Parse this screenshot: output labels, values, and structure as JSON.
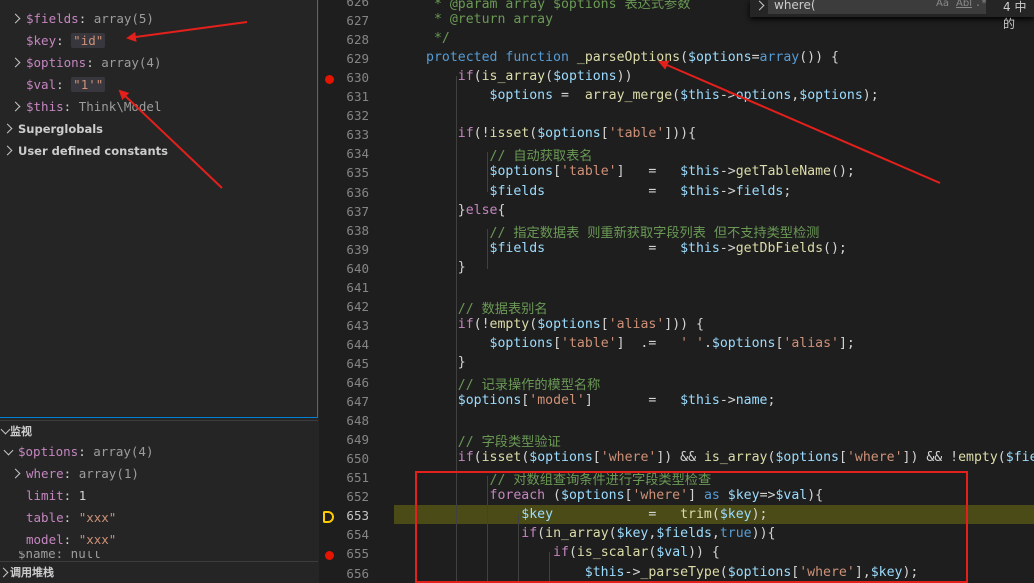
{
  "variables": [
    {
      "name": "$fields",
      "type": "array(5)",
      "expandable": true
    },
    {
      "name": "$key",
      "value": "\"id\"",
      "expandable": false
    },
    {
      "name": "$options",
      "type": "array(4)",
      "expandable": true
    },
    {
      "name": "$val",
      "value": "\"1'\"",
      "expandable": false
    },
    {
      "name": "$this",
      "type": "Think\\Model",
      "expandable": true
    }
  ],
  "sections": [
    "Superglobals",
    "User defined constants"
  ],
  "watch": {
    "title": "监视",
    "root": {
      "name": "$options",
      "type": "array(4)"
    },
    "children": [
      {
        "name": "where",
        "value": "array(1)",
        "kind": "type",
        "expandable": true
      },
      {
        "name": "limit",
        "value": "1",
        "kind": "num"
      },
      {
        "name": "table",
        "value": "\"xxx\"",
        "kind": "str"
      },
      {
        "name": "model",
        "value": "\"xxx\"",
        "kind": "str"
      }
    ],
    "partial": "$name: null"
  },
  "callstack": {
    "title": "调用堆栈"
  },
  "find": {
    "query": "where(",
    "aa": "Aa",
    "ab": "Abl",
    "regex": ".*",
    "result": "4 中的"
  },
  "editor": {
    "current_line": 653,
    "breakpoints": [
      630,
      655
    ],
    "lines": [
      {
        "n": 626,
        "html": "<span class=\"cm\"> * @param array $options 表达式参数</span>"
      },
      {
        "n": 627,
        "html": "<span class=\"cm\"> * @return array</span>"
      },
      {
        "n": 628,
        "html": "<span class=\"cm\"> */</span>"
      },
      {
        "n": 629,
        "html": "<span class=\"kw\">protected function</span> <span class=\"fn\">_parseOptions</span>(<span class=\"var\">$options</span>=<span class=\"kw\">array</span>()) {"
      },
      {
        "n": 630,
        "html": "    <span class=\"kw2\">if</span>(<span class=\"fn\">is_array</span>(<span class=\"var\">$options</span>))"
      },
      {
        "n": 631,
        "html": "        <span class=\"var\">$options</span> =  <span class=\"fn\">array_merge</span>(<span class=\"var\">$this</span>-><span class=\"var\">options</span>,<span class=\"var\">$options</span>);"
      },
      {
        "n": 632,
        "html": ""
      },
      {
        "n": 633,
        "html": "    <span class=\"kw2\">if</span>(!<span class=\"fn\">isset</span>(<span class=\"var\">$options</span>[<span class=\"str\">'table'</span>])){"
      },
      {
        "n": 634,
        "html": "        <span class=\"cm\">// 自动获取表名</span>"
      },
      {
        "n": 635,
        "html": "        <span class=\"var\">$options</span>[<span class=\"str\">'table'</span>]   =   <span class=\"var\">$this</span>-><span class=\"fn\">getTableName</span>();"
      },
      {
        "n": 636,
        "html": "        <span class=\"var\">$fields</span>             =   <span class=\"var\">$this</span>-><span class=\"var\">fields</span>;"
      },
      {
        "n": 637,
        "html": "    }<span class=\"kw2\">else</span>{"
      },
      {
        "n": 638,
        "html": "        <span class=\"cm\">// 指定数据表 则重新获取字段列表 但不支持类型检测</span>"
      },
      {
        "n": 639,
        "html": "        <span class=\"var\">$fields</span>             =   <span class=\"var\">$this</span>-><span class=\"fn\">getDbFields</span>();"
      },
      {
        "n": 640,
        "html": "    }"
      },
      {
        "n": 641,
        "html": ""
      },
      {
        "n": 642,
        "html": "    <span class=\"cm\">// 数据表别名</span>"
      },
      {
        "n": 643,
        "html": "    <span class=\"kw2\">if</span>(!<span class=\"fn\">empty</span>(<span class=\"var\">$options</span>[<span class=\"str\">'alias'</span>])) {"
      },
      {
        "n": 644,
        "html": "        <span class=\"var\">$options</span>[<span class=\"str\">'table'</span>]  .=   <span class=\"str\">' '</span>.<span class=\"var\">$options</span>[<span class=\"str\">'alias'</span>];"
      },
      {
        "n": 645,
        "html": "    }"
      },
      {
        "n": 646,
        "html": "    <span class=\"cm\">// 记录操作的模型名称</span>"
      },
      {
        "n": 647,
        "html": "    <span class=\"var\">$options</span>[<span class=\"str\">'model'</span>]       =   <span class=\"var\">$this</span>-><span class=\"var\">name</span>;"
      },
      {
        "n": 648,
        "html": ""
      },
      {
        "n": 649,
        "html": "    <span class=\"cm\">// 字段类型验证</span>"
      },
      {
        "n": 650,
        "html": "    <span class=\"kw2\">if</span>(<span class=\"fn\">isset</span>(<span class=\"var\">$options</span>[<span class=\"str\">'where'</span>]) &amp;&amp; <span class=\"fn\">is_array</span>(<span class=\"var\">$options</span>[<span class=\"str\">'where'</span>]) &amp;&amp; !<span class=\"fn\">empty</span>(<span class=\"var\">$fields</span>"
      },
      {
        "n": 651,
        "html": "        <span class=\"cm\">// 对数组查询条件进行字段类型检查</span>"
      },
      {
        "n": 652,
        "html": "        <span class=\"kw2\">foreach</span> (<span class=\"var\">$options</span>[<span class=\"str\">'where'</span>] <span class=\"kw\">as</span> <span class=\"var\">$key</span>=><span class=\"var\">$val</span>){"
      },
      {
        "n": 653,
        "html": "            <span class=\"var\">$key</span>            =   <span class=\"fn\">trim</span>(<span class=\"var\">$key</span>);"
      },
      {
        "n": 654,
        "html": "            <span class=\"kw2\">if</span>(<span class=\"fn\">in_array</span>(<span class=\"var\">$key</span>,<span class=\"var\">$fields</span>,<span class=\"kw\">true</span>)){"
      },
      {
        "n": 655,
        "html": "                <span class=\"kw2\">if</span>(<span class=\"fn\">is_scalar</span>(<span class=\"var\">$val</span>)) {"
      },
      {
        "n": 656,
        "html": "                    <span class=\"var\">$this</span>-><span class=\"fn\">_parseType</span>(<span class=\"var\">$options</span>[<span class=\"str\">'where'</span>],<span class=\"var\">$key</span>);"
      }
    ]
  }
}
